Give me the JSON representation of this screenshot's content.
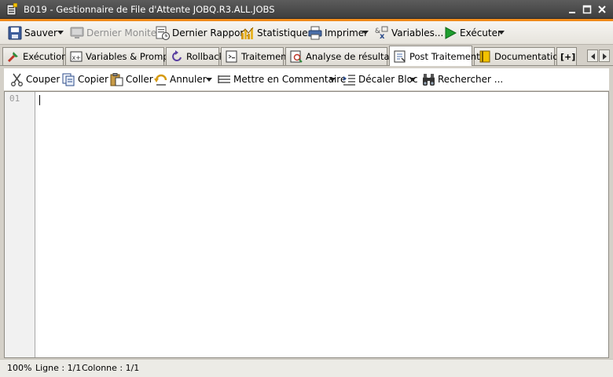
{
  "window": {
    "title": "B019 - Gestionnaire de File d'Attente JOBQ.R3.ALL.JOBS",
    "icon": "queue-manager-icon"
  },
  "main_toolbar": {
    "save": "Sauver",
    "last_monitor": "Dernier Moniteur",
    "last_report": "Dernier Rapport",
    "statistics": "Statistiques",
    "print": "Imprimer",
    "variables": "Variables...",
    "execute": "Exécuter"
  },
  "tabs": [
    {
      "label": "Exécution",
      "icon": "execution-icon"
    },
    {
      "label": "Variables & Prompts",
      "icon": "variables-prompts-icon"
    },
    {
      "label": "Rollback",
      "icon": "rollback-icon"
    },
    {
      "label": "Traitement",
      "icon": "processing-icon"
    },
    {
      "label": "Analyse de résultats",
      "icon": "results-analysis-icon"
    },
    {
      "label": "Post Traitement",
      "icon": "post-processing-icon",
      "active": true
    },
    {
      "label": "Documentation",
      "icon": "documentation-icon"
    }
  ],
  "tab_add_glyph": "[+]",
  "edit_toolbar": {
    "cut": "Couper",
    "copy": "Copier",
    "paste": "Coller",
    "undo": "Annuler",
    "comment": "Mettre en Commentaire",
    "shift_block": "Décaler Bloc",
    "search": "Rechercher ..."
  },
  "editor": {
    "line_numbers": [
      "01"
    ],
    "content": ""
  },
  "status": {
    "zoom": "100%",
    "line": "Ligne : 1/1",
    "column": "Colonne : 1/1"
  },
  "colors": {
    "accent_strip": "#f08a1a",
    "title_bar": "#4a4a4a",
    "execute_green": "#1e9e2e"
  }
}
